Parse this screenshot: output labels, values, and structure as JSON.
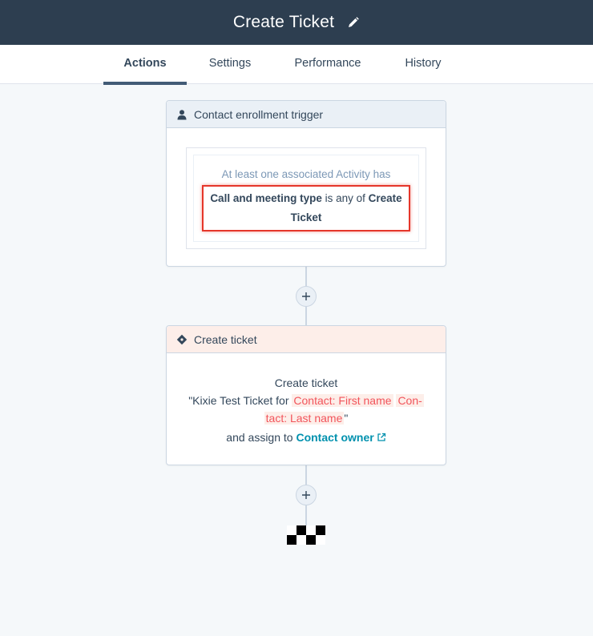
{
  "header": {
    "title": "Create Ticket",
    "edit_icon": "pencil-icon"
  },
  "tabs": [
    {
      "label": "Actions",
      "active": true
    },
    {
      "label": "Settings",
      "active": false
    },
    {
      "label": "Performance",
      "active": false
    },
    {
      "label": "History",
      "active": false
    }
  ],
  "trigger": {
    "icon": "contact-person-icon",
    "title": "Contact enrollment trigger",
    "filter_heading": "At least one associated Activity has",
    "filter_property": "Call and meeting type",
    "filter_operator": "is any of",
    "filter_value": "Create Ticket",
    "highlight_color": "#e5362a"
  },
  "action": {
    "icon": "ticket-icon",
    "title": "Create ticket",
    "line1": "Create ticket",
    "quote_open": "\"Kixie Test Ticket for",
    "token1": "Contact: First name",
    "token2a": "Con-",
    "token2b": "tact: Last name",
    "quote_close": "\"",
    "assign_text": "and assign to",
    "assign_link": "Contact owner",
    "assign_link_icon": "external-link-icon"
  },
  "add_step_icon": "plus-icon",
  "end_icon": "checkered-flag-icon"
}
